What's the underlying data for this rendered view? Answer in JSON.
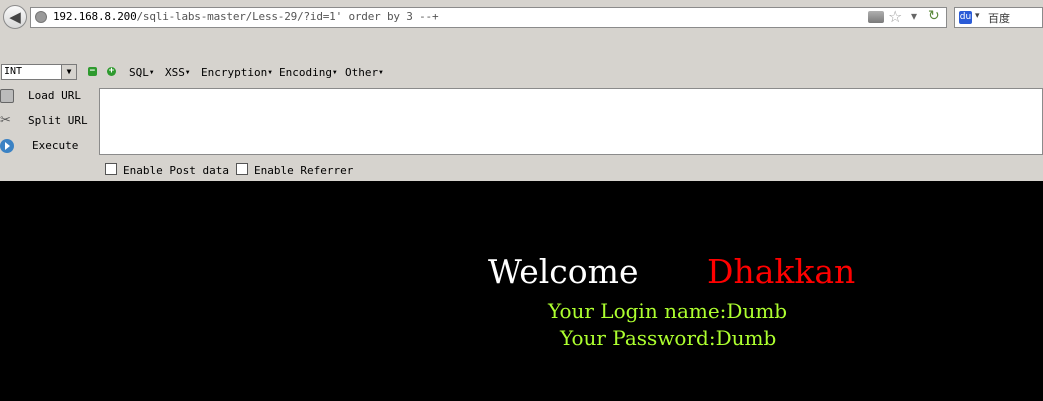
{
  "browser": {
    "url_host": "192.168.8.200",
    "url_path": "/sqli-labs-master/Less-29/?id=1' order by 3 --+",
    "search_engine_text": "百度"
  },
  "hackbar": {
    "type_select": "INT",
    "menus": [
      "SQL",
      "XSS",
      "Encryption",
      "Encoding",
      "Other"
    ],
    "actions": [
      "Load URL",
      "Split URL",
      "Execute"
    ],
    "textarea_value": "",
    "post_label": "Enable Post data",
    "referrer_label": "Enable Referrer"
  },
  "page": {
    "welcome": "Welcome",
    "user": "Dhakkan",
    "login_line": "Your Login name:Dumb",
    "password_line": "Your Password:Dumb"
  },
  "colors": {
    "background": "#000000",
    "welcome": "#ffffff",
    "user": "#ff0000",
    "info": "#adff2f"
  }
}
